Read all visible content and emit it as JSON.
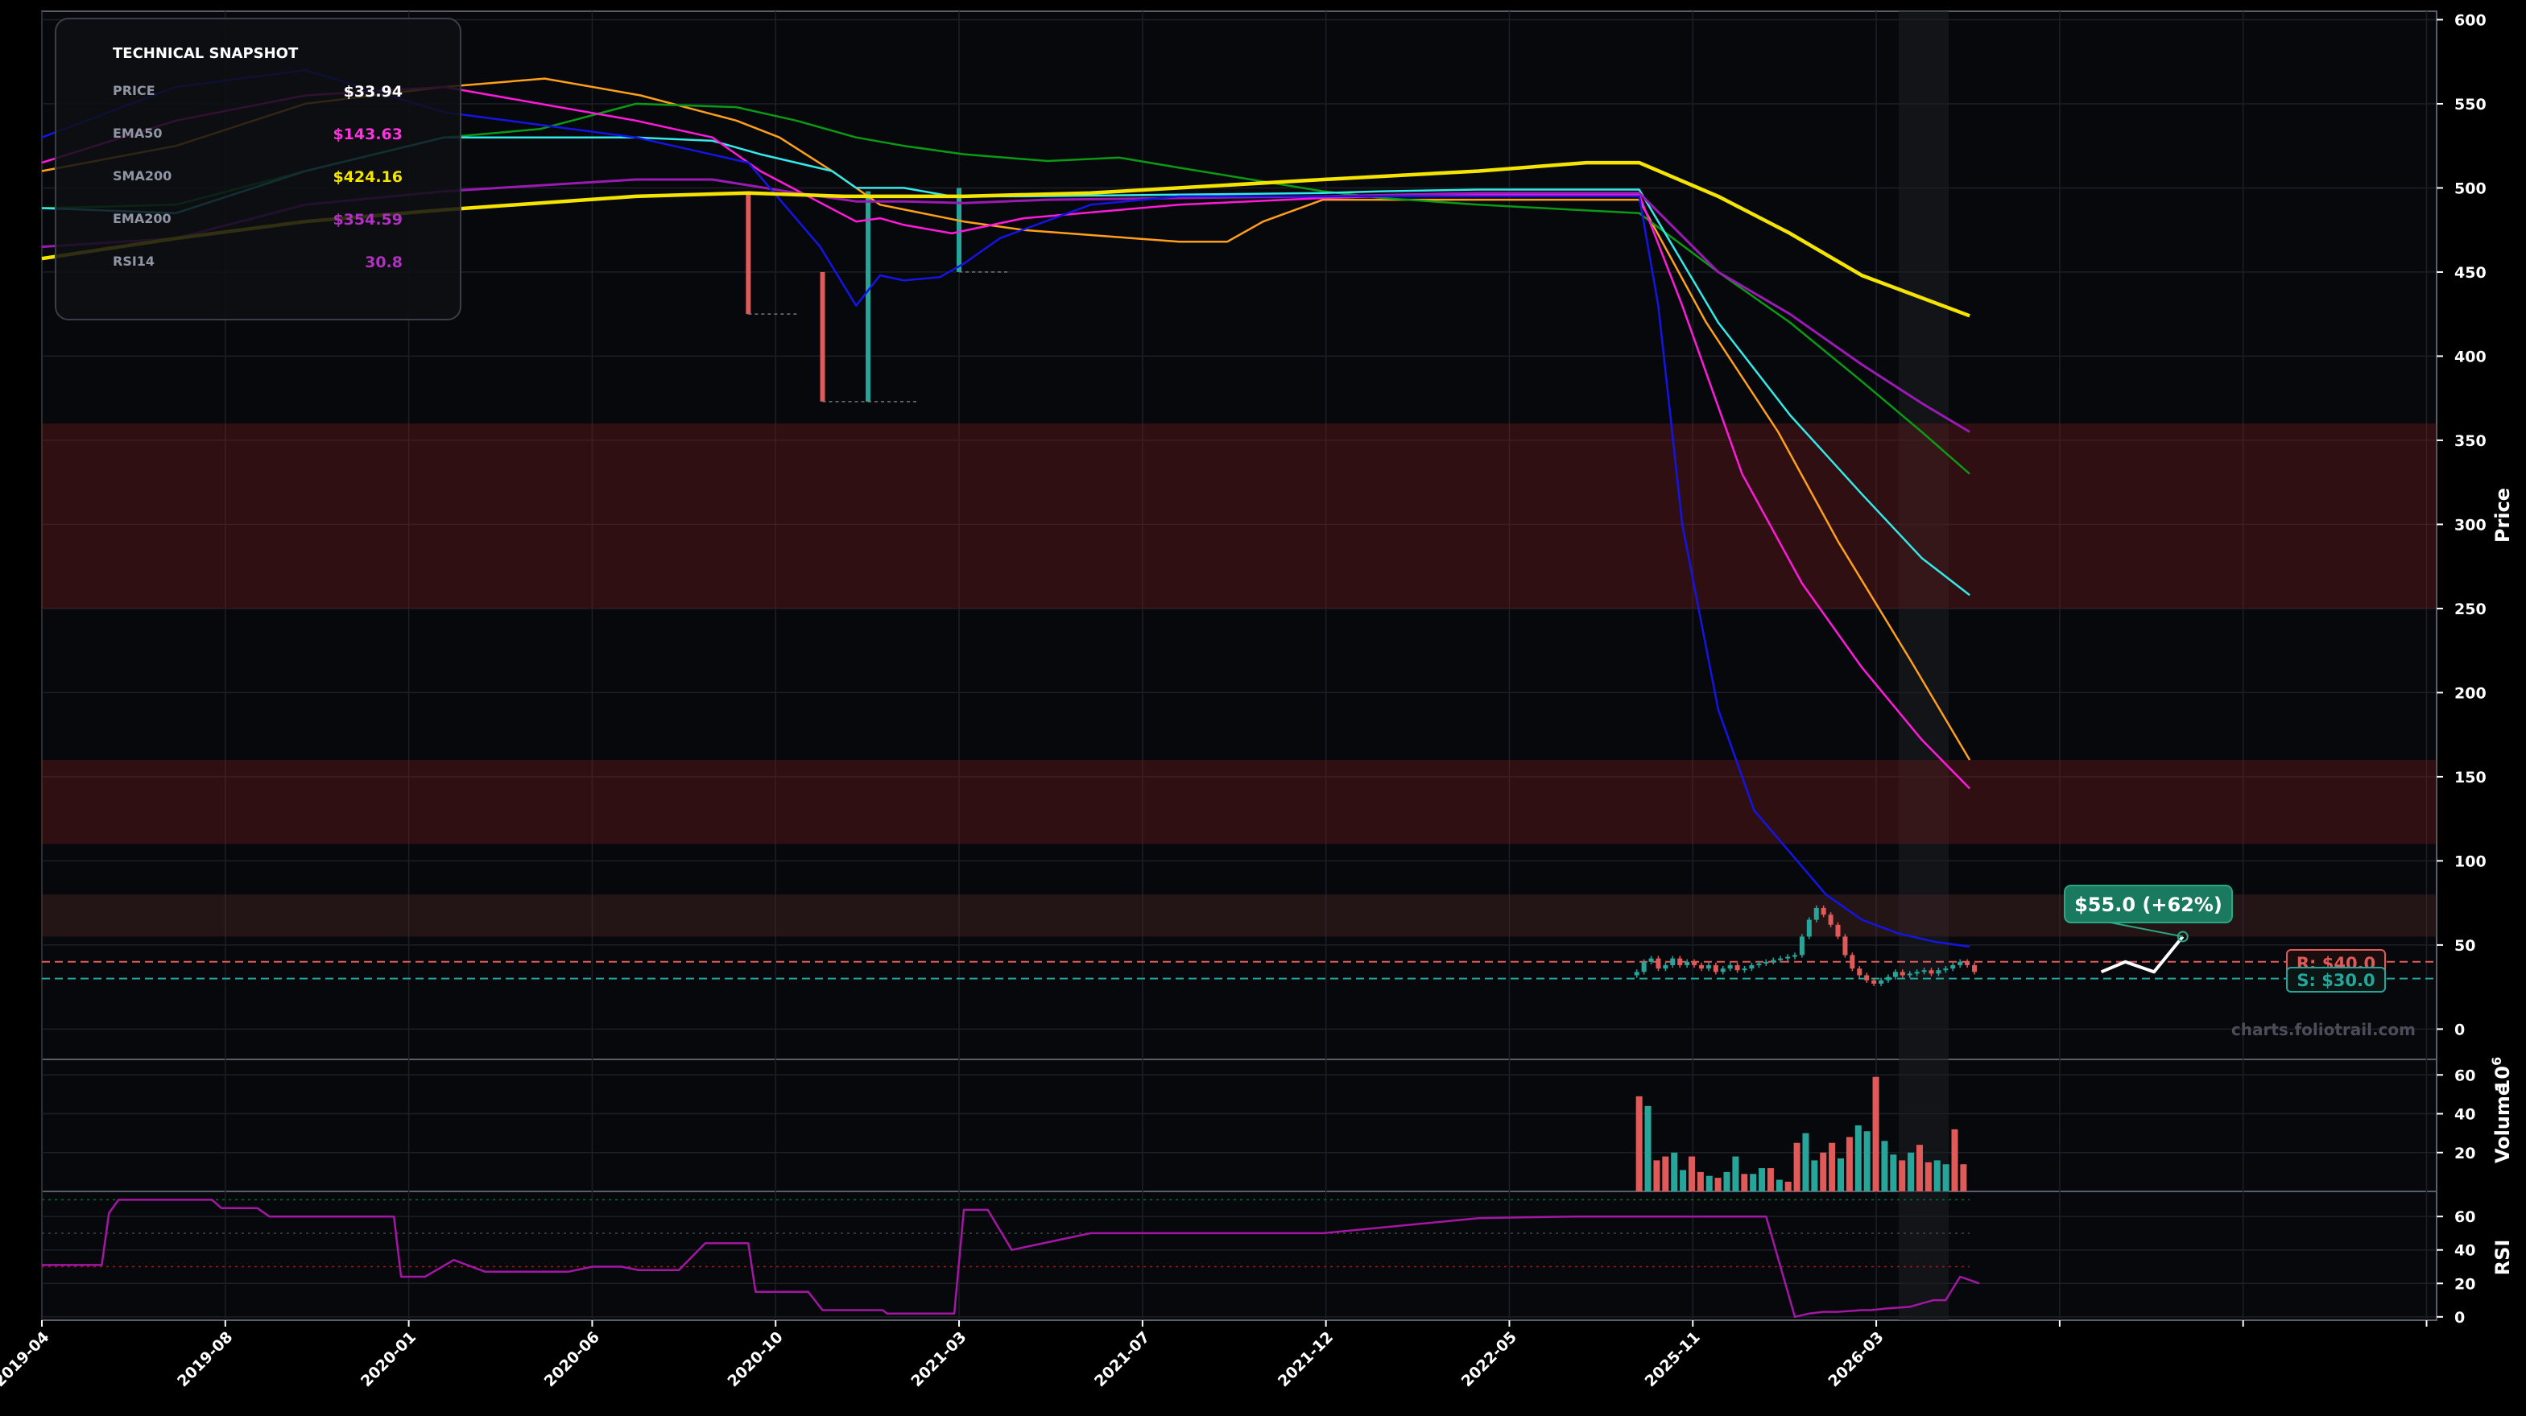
{
  "chart_data": {
    "type": "line",
    "x_tick_labels": [
      "2019-04",
      "2019-08",
      "2020-01",
      "2020-06",
      "2020-10",
      "2021-03",
      "2021-07",
      "2021-12",
      "2022-05",
      "2025-11",
      "2026-03"
    ],
    "price_axis": {
      "label": "Price",
      "ylim": [
        -18,
        605
      ],
      "ticks": [
        0,
        50,
        100,
        150,
        200,
        250,
        300,
        350,
        400,
        450,
        500,
        550,
        600
      ]
    },
    "volume_axis": {
      "label": "Volume",
      "multiplier": "10",
      "exponent": "6",
      "ylim": [
        0,
        68
      ],
      "ticks": [
        20,
        40,
        60
      ]
    },
    "rsi_axis": {
      "label": "RSI",
      "ylim": [
        -2,
        75
      ],
      "ticks": [
        0,
        20,
        40,
        60
      ],
      "overbought": 70,
      "oversold": 30
    },
    "grid": true,
    "watermark": "charts.foliotrail.com",
    "zones": [
      {
        "low": 250,
        "high": 360,
        "color": "#7a1c1c"
      },
      {
        "low": 110,
        "high": 160,
        "color": "#7a1c1c"
      },
      {
        "low": 55,
        "high": 80,
        "color": "#5a2a2a"
      }
    ],
    "levels": {
      "resistance": {
        "value": 40.0,
        "label": "R: $40.0",
        "color": "#e05a5a"
      },
      "support": {
        "value": 30.0,
        "label": "S: $30.0",
        "color": "#26a69a"
      }
    },
    "target": {
      "label": "$55.0 (+62%)",
      "value": 55.0
    },
    "forecast": {
      "x": [
        86.0,
        87.0,
        88.2,
        89.4
      ],
      "y": [
        34,
        40,
        34,
        55
      ]
    },
    "snapshot": {
      "title": "TECHNICAL SNAPSHOT",
      "rows": [
        {
          "label": "PRICE",
          "value": "$33.94",
          "color": "#ffffff"
        },
        {
          "label": "EMA50",
          "value": "$143.63",
          "color": "#ff33dd"
        },
        {
          "label": "SMA200",
          "value": "$424.16",
          "color": "#f5e400"
        },
        {
          "label": "EMA200",
          "value": "$354.59",
          "color": "#b030c0"
        },
        {
          "label": "RSI14",
          "value": "30.8",
          "color": "#b030c0"
        }
      ]
    },
    "series": [
      {
        "key": "orange",
        "color": "#ff9f1a",
        "width": 2.5,
        "x": [
          0,
          5.6,
          11,
          16.8,
          21,
          25,
          29,
          30.8,
          33,
          35,
          38.5,
          41,
          43.8,
          47.5,
          49.5,
          51,
          53.5,
          66.7,
          69.5,
          72.5,
          75,
          78,
          80.5
        ],
        "y": [
          510,
          525,
          550,
          560,
          565,
          555,
          540,
          530,
          510,
          490,
          480,
          475,
          472,
          468,
          468,
          480,
          493,
          493,
          420,
          355,
          290,
          220,
          160
        ]
      },
      {
        "key": "green",
        "color": "#0a9a14",
        "width": 2.5,
        "x": [
          0,
          5.6,
          11,
          16.8,
          20.8,
          24.8,
          29,
          31.5,
          34,
          36,
          38.5,
          42,
          45,
          47.5,
          53.5,
          56,
          60,
          64,
          66.7,
          70,
          73,
          76,
          78.5,
          80.5
        ],
        "y": [
          488,
          490,
          510,
          530,
          535,
          550,
          548,
          540,
          530,
          525,
          520,
          516,
          518,
          512,
          498,
          494,
          490,
          487,
          485,
          450,
          420,
          385,
          355,
          330
        ]
      },
      {
        "key": "cyan",
        "color": "#33e9e9",
        "width": 2.5,
        "x": [
          0,
          5.6,
          11,
          16.8,
          24.8,
          28,
          30,
          33,
          34,
          36,
          38,
          41,
          47.5,
          53.5,
          56,
          60,
          64,
          66.7,
          70,
          73,
          76,
          78.5,
          80.5
        ],
        "y": [
          488,
          485,
          510,
          530,
          530,
          528,
          520,
          510,
          500,
          500,
          495,
          495,
          496,
          497,
          498,
          499,
          499,
          499,
          420,
          365,
          318,
          280,
          258
        ]
      },
      {
        "key": "magenta",
        "color": "#ff1adb",
        "width": 2.5,
        "x": [
          0,
          5.6,
          11,
          16.8,
          24.8,
          28,
          30,
          32,
          34,
          35,
          36,
          38,
          41,
          47.5,
          53.5,
          56,
          60,
          64,
          66.7,
          68.5,
          71,
          73.5,
          76,
          78.5,
          80.5
        ],
        "y": [
          515,
          540,
          555,
          560,
          540,
          530,
          510,
          495,
          480,
          482,
          478,
          473,
          482,
          490,
          494,
          495,
          496,
          496,
          496,
          430,
          330,
          265,
          215,
          172,
          143
        ]
      },
      {
        "key": "purple",
        "color": "#9a1ab4",
        "width": 3,
        "x": [
          0,
          5.6,
          11,
          16.8,
          24.8,
          28,
          31.5,
          34,
          36,
          38.5,
          42,
          47.5,
          53.5,
          60,
          66.7,
          70,
          73,
          76,
          78.5,
          80.5
        ],
        "y": [
          465,
          470,
          490,
          498,
          505,
          505,
          497,
          492,
          492,
          491,
          493,
          494,
          495,
          497,
          497,
          450,
          425,
          395,
          372,
          355
        ]
      },
      {
        "key": "blue",
        "color": "#1414e6",
        "width": 2.5,
        "x": [
          0,
          5.6,
          11,
          16.8,
          24.8,
          29.5,
          32.5,
          34,
          35,
          36,
          37.5,
          38.5,
          40,
          43.8,
          47.5,
          53.5,
          60,
          66.7,
          67.5,
          68.5,
          70,
          71.5,
          73,
          74.5,
          76,
          77.5,
          79,
          80.5
        ],
        "y": [
          530,
          560,
          570,
          545,
          530,
          515,
          465,
          430,
          448,
          445,
          447,
          455,
          470,
          490,
          495,
          495,
          495,
          495,
          430,
          300,
          190,
          130,
          105,
          80,
          65,
          57,
          52,
          49
        ]
      },
      {
        "key": "yellow",
        "color": "#f5e400",
        "width": 4.5,
        "x": [
          0,
          5.6,
          11,
          16.8,
          24.8,
          29.5,
          33.5,
          38.5,
          43.8,
          47.5,
          53.5,
          60,
          64.5,
          66.7,
          70,
          73,
          76,
          80.5
        ],
        "y": [
          458,
          470,
          480,
          487,
          495,
          497,
          495,
          495,
          497,
          500,
          505,
          510,
          515,
          515,
          495,
          473,
          448,
          424
        ]
      }
    ],
    "price_spikes": [
      {
        "x": 29.5,
        "top": 498,
        "bottom": 425,
        "color": "#e05a5a"
      },
      {
        "x": 32.6,
        "top": 450,
        "bottom": 373,
        "color": "#e05a5a"
      },
      {
        "x": 34.5,
        "top": 498,
        "bottom": 373,
        "color": "#26a69a"
      },
      {
        "x": 38.3,
        "top": 500,
        "bottom": 450,
        "color": "#26a69a"
      }
    ],
    "candles": {
      "x": [
        66.6,
        66.9,
        67.2,
        67.5,
        67.8,
        68.1,
        68.4,
        68.7,
        69.0,
        69.3,
        69.6,
        69.9,
        70.2,
        70.5,
        70.8,
        71.1,
        71.4,
        71.7,
        72.0,
        72.3,
        72.6,
        72.9,
        73.2,
        73.5,
        73.8,
        74.1,
        74.4,
        74.7,
        75.0,
        75.3,
        75.6,
        75.9,
        76.2,
        76.5,
        76.8,
        77.1,
        77.4,
        77.7,
        78.0,
        78.3,
        78.6,
        78.9,
        79.2,
        79.5,
        79.8,
        80.1,
        80.4,
        80.7
      ],
      "open": [
        32,
        34,
        40,
        42,
        36,
        38,
        42,
        38,
        40,
        38,
        36,
        38,
        34,
        36,
        38,
        35,
        36,
        38,
        39,
        40,
        41,
        42,
        43,
        44,
        55,
        65,
        72,
        68,
        62,
        55,
        44,
        36,
        32,
        29,
        27,
        29,
        31,
        34,
        32,
        33,
        34,
        35,
        33,
        35,
        36,
        38,
        40,
        38
      ],
      "close": [
        34,
        40,
        42,
        36,
        38,
        42,
        38,
        40,
        38,
        36,
        38,
        34,
        36,
        38,
        35,
        36,
        38,
        39,
        40,
        41,
        42,
        43,
        44,
        55,
        65,
        72,
        68,
        62,
        55,
        44,
        36,
        32,
        29,
        27,
        29,
        31,
        34,
        32,
        33,
        34,
        35,
        33,
        35,
        36,
        38,
        40,
        38,
        34
      ]
    },
    "volume": [
      49,
      44,
      16,
      18,
      20,
      11,
      18,
      10,
      8,
      7,
      10,
      18,
      9,
      9,
      12,
      12,
      6,
      5,
      25,
      30,
      16,
      20,
      25,
      17,
      28,
      34,
      31,
      59,
      26,
      19,
      16,
      20,
      24,
      15,
      16,
      14,
      32,
      14
    ],
    "volume_x_start": 66.7,
    "volume_x_step": 0.366,
    "rsi": {
      "x": [
        0,
        2.5,
        2.8,
        3.2,
        4.7,
        5.6,
        6.3,
        7.1,
        7.5,
        9,
        9.5,
        10.7,
        11.5,
        12.5,
        13,
        13.5,
        14,
        14.4,
        14.7,
        15.0,
        16,
        17.2,
        18.5,
        20,
        22,
        23,
        23.5,
        24.2,
        24.9,
        25,
        25.6,
        26.2,
        26.6,
        27.7,
        29.5,
        29.8,
        30.5,
        31.5,
        32,
        32.6,
        34.1,
        34.4,
        34.7,
        35.1,
        35.3,
        35.9,
        37.5,
        38.1,
        38.5,
        39.5,
        40.5,
        43.8,
        47.5,
        53.5,
        60,
        64,
        66.5,
        66.7,
        67.0,
        67.5,
        68.5,
        69.3,
        70,
        71,
        72,
        73.2,
        73.8,
        74.4,
        75,
        76,
        76.4,
        77,
        78,
        78.5,
        79,
        79.5,
        80.1,
        80.5,
        80.9
      ],
      "y": [
        31,
        31,
        62,
        70,
        70,
        70,
        70,
        70,
        65,
        65,
        60,
        60,
        60,
        60,
        60,
        60,
        60,
        60,
        60,
        24,
        24,
        34,
        27,
        27,
        27,
        30,
        30,
        30,
        28,
        28,
        28,
        28,
        28,
        44,
        44,
        15,
        15,
        15,
        15,
        4,
        4,
        4,
        4,
        4,
        2,
        2,
        2,
        2,
        64,
        64,
        40,
        50,
        50,
        50,
        59,
        60,
        60,
        60,
        60,
        60,
        60,
        60,
        60,
        60,
        60,
        0,
        2,
        3,
        3,
        4,
        4,
        5,
        6,
        8,
        10,
        10,
        24,
        22,
        20,
        19,
        19,
        24,
        23,
        25,
        25,
        27,
        28,
        32,
        34,
        30
      ]
    }
  }
}
